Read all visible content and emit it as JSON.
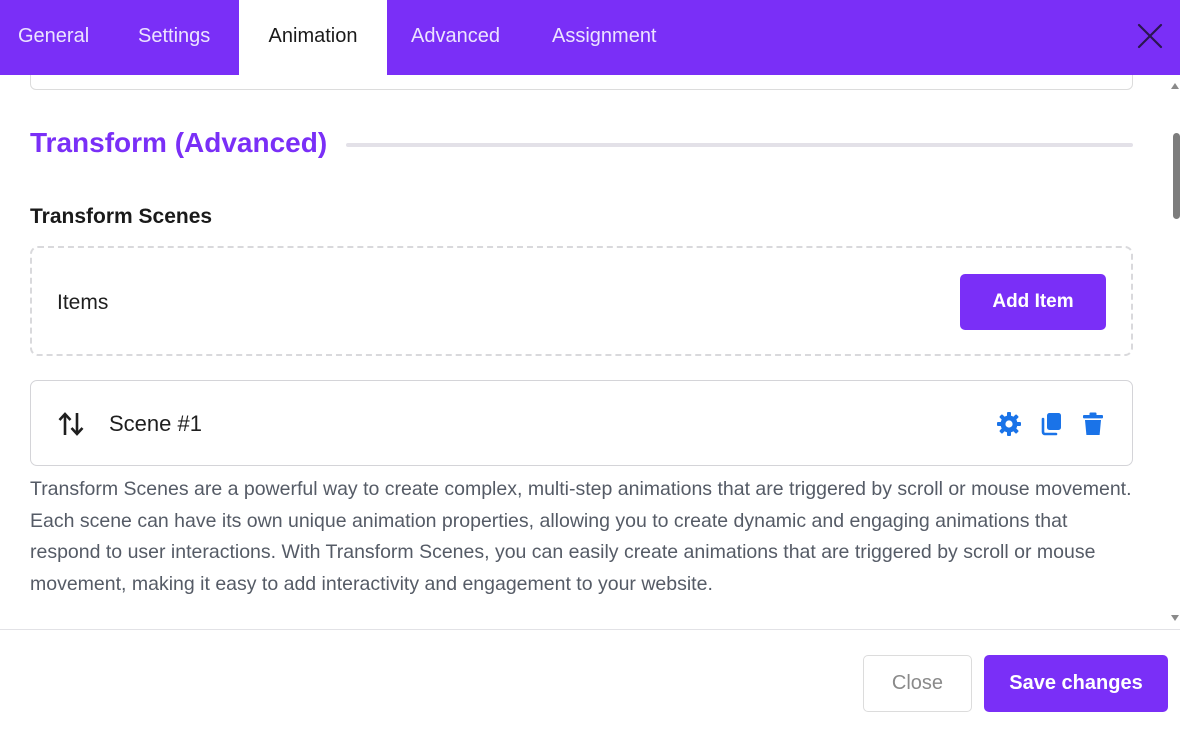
{
  "tabs": [
    {
      "label": "General",
      "active": false
    },
    {
      "label": "Settings",
      "active": false
    },
    {
      "label": "Animation",
      "active": true
    },
    {
      "label": "Advanced",
      "active": false
    },
    {
      "label": "Assignment",
      "active": false
    }
  ],
  "section": {
    "title": "Transform (Advanced)",
    "subtitle": "Transform Scenes"
  },
  "items_box": {
    "label": "Items",
    "add_button": "Add Item"
  },
  "scenes": [
    {
      "label": "Scene #1",
      "actions": [
        "gear-icon",
        "copy-icon",
        "trash-icon"
      ]
    }
  ],
  "description": "Transform Scenes are a powerful way to create complex, multi-step animations that are triggered by scroll or mouse movement. Each scene can have its own unique animation properties, allowing you to create dynamic and engaging animations that respond to user interactions. With Transform Scenes, you can easily create animations that are triggered by scroll or mouse movement, making it easy to add interactivity and engagement to your website.",
  "footer": {
    "close_label": "Close",
    "save_label": "Save changes"
  },
  "colors": {
    "accent": "#7a2ff7",
    "icon_blue": "#1a73e8"
  }
}
